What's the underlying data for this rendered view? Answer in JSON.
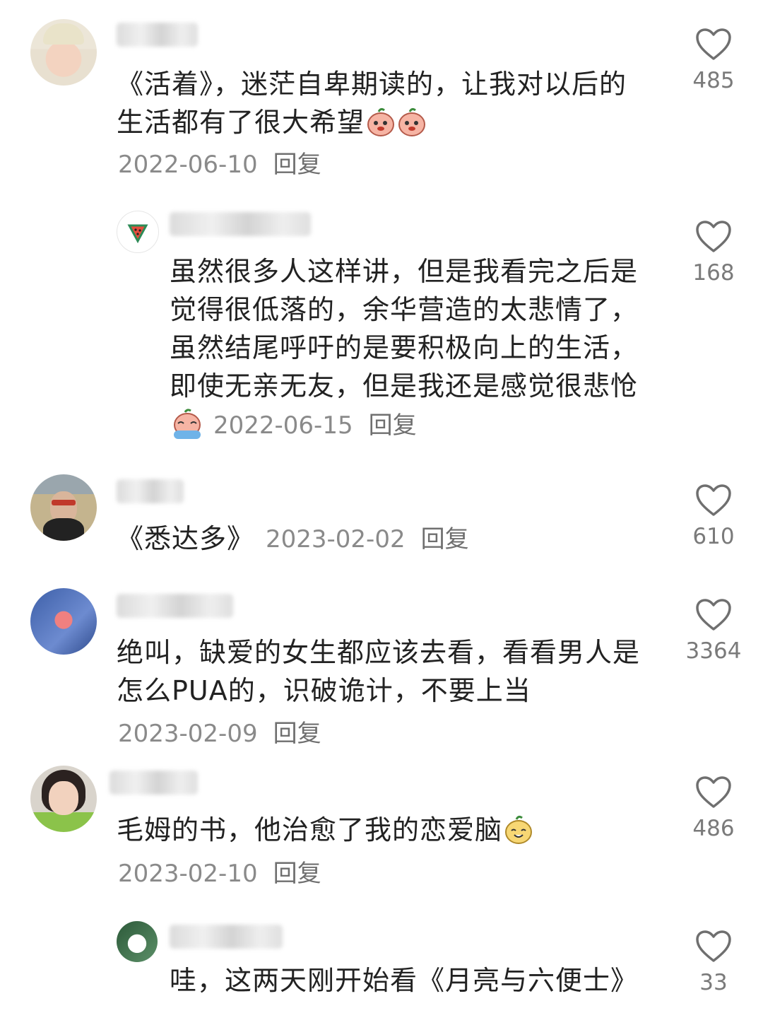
{
  "comments": [
    {
      "text": "《活着》，迷茫自卑期读的，让我对以后的生活都有了很大希望",
      "date": "2022-06-10",
      "reply_label": "回复",
      "likes": "485"
    },
    {
      "text": "虽然很多人这样讲，但是我看完之后是觉得很低落的，余华营造的太悲情了，虽然结尾呼吁的是要积极向上的生活，即使无亲无友，但是我还是感觉很悲怆",
      "date": "2022-06-15",
      "reply_label": "回复",
      "likes": "168"
    },
    {
      "text": "《悉达多》",
      "date": "2023-02-02",
      "reply_label": "回复",
      "likes": "610"
    },
    {
      "text": "绝叫，缺爱的女生都应该去看，看看男人是怎么PUA的，识破诡计，不要上当",
      "date": "2023-02-09",
      "reply_label": "回复",
      "likes": "3364"
    },
    {
      "text": "毛姆的书，他治愈了我的恋爱脑",
      "date": "2023-02-10",
      "reply_label": "回复",
      "likes": "486"
    },
    {
      "text": "哇，这两天刚开始看《月亮与六便士》",
      "likes": "33"
    }
  ],
  "icons": {
    "like": "heart-outline-icon",
    "emoji_peach": "peach-emoji-icon",
    "emoji_crying": "crying-emoji-icon",
    "emoji_happy": "happy-emoji-icon"
  },
  "colors": {
    "text": "#222222",
    "meta": "#8a8a8a",
    "heart": "#6f6f6f"
  }
}
